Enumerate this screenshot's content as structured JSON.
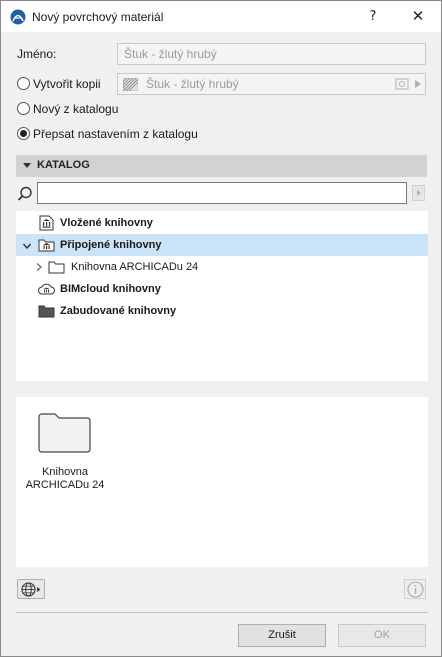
{
  "window": {
    "title": "Nový povrchový materiál",
    "help_label": "?",
    "close_label": "✕"
  },
  "name_row": {
    "label": "Jméno:",
    "value": "Štuk - žlutý hrubý"
  },
  "options": {
    "copy": {
      "label": "Vytvořit kopii",
      "checked": false,
      "source_value": "Štuk - žlutý hrubý"
    },
    "new_from_catalog": {
      "label": "Nový z katalogu",
      "checked": false
    },
    "overwrite": {
      "label": "Přepsat nastavením z katalogu",
      "checked": true
    }
  },
  "catalog": {
    "header": "KATALOG",
    "search": {
      "value": "",
      "placeholder": ""
    },
    "tree": [
      {
        "label": "Vložené knihovny",
        "icon": "embedded-library-icon",
        "bold": true,
        "selected": false,
        "expanded": null,
        "level": 0
      },
      {
        "label": "Připojené knihovny",
        "icon": "linked-library-icon",
        "bold": true,
        "selected": true,
        "expanded": true,
        "level": 0
      },
      {
        "label": "Knihovna ARCHICADu 24",
        "icon": "folder-icon",
        "bold": false,
        "selected": false,
        "expanded": false,
        "level": 1
      },
      {
        "label": "BIMcloud knihovny",
        "icon": "bimcloud-library-icon",
        "bold": true,
        "selected": false,
        "expanded": null,
        "level": 0
      },
      {
        "label": "Zabudované knihovny",
        "icon": "builtin-library-folder-icon",
        "bold": true,
        "selected": false,
        "expanded": null,
        "level": 0
      }
    ],
    "preview_item": {
      "label_line1": "Knihovna",
      "label_line2": "ARCHICADu 24",
      "icon": "folder-icon"
    }
  },
  "footer": {
    "cancel_label": "Zrušit",
    "ok_label": "OK",
    "ok_enabled": false
  },
  "colors": {
    "selection": "#cce4f7",
    "header_bg": "#d2d2d2"
  }
}
